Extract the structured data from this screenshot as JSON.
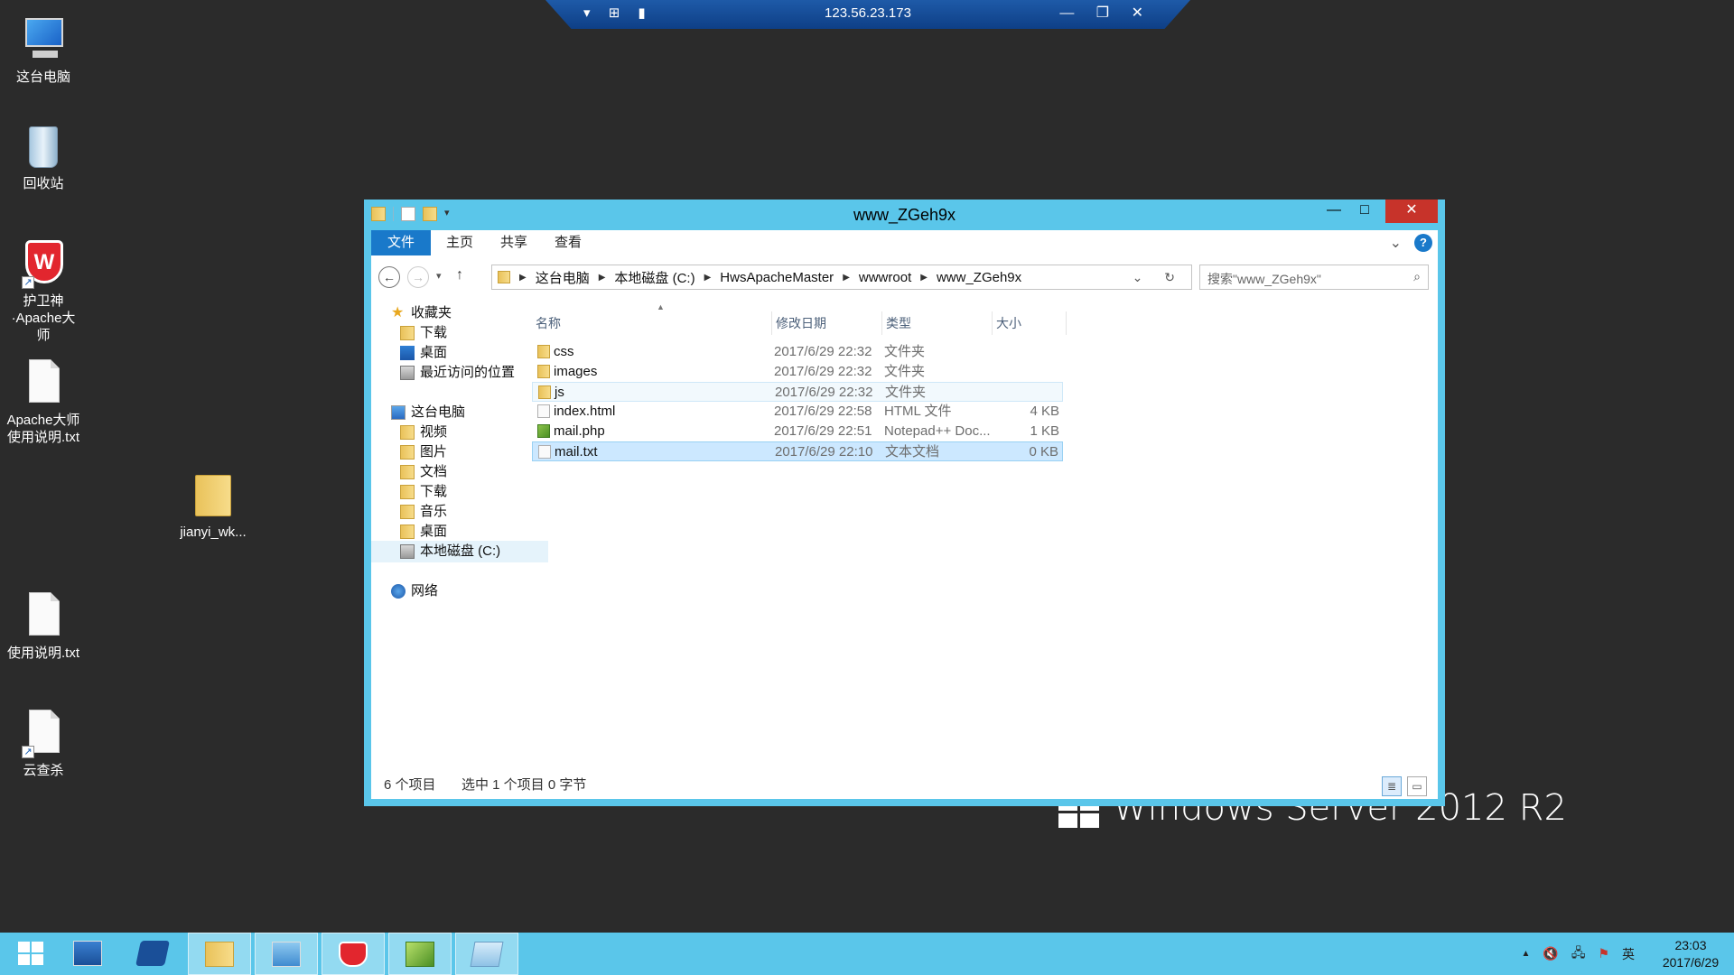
{
  "remote": {
    "host": "123.56.23.173",
    "left_icons": "▾ ⊞ ▮",
    "right_icons": "— ❐ ✕"
  },
  "desktop": {
    "icons": [
      {
        "label": "这台电脑",
        "icon": "computer-icon"
      },
      {
        "label": "回收站",
        "icon": "recycle-bin-icon"
      },
      {
        "label": "护卫神·Apache大师",
        "icon": "huweishen-shield-icon"
      },
      {
        "label": "Apache大师使用说明.txt",
        "icon": "text-file-icon"
      },
      {
        "label": "jianyi_wk...",
        "icon": "folder-icon"
      },
      {
        "label": "使用说明.txt",
        "icon": "text-file-icon"
      },
      {
        "label": "云查杀",
        "icon": "text-file-icon"
      }
    ],
    "watermark": "Windows Server 2012 R2"
  },
  "explorer": {
    "title": "www_ZGeh9x",
    "controls": {
      "min": "—",
      "max": "□",
      "close": "✕"
    },
    "ribbon_tabs": [
      "文件",
      "主页",
      "共享",
      "查看"
    ],
    "help": "?",
    "expand": "⌄",
    "nav_back": "←",
    "nav_fwd": "→",
    "nav_recent": "▾",
    "nav_up": "↑",
    "breadcrumbs": [
      "这台电脑",
      "本地磁盘 (C:)",
      "HwsApacheMaster",
      "wwwroot",
      "www_ZGeh9x"
    ],
    "crumb_sep": "▶",
    "address_tail": "⌄ ↻",
    "search_placeholder": "搜索\"www_ZGeh9x\"",
    "search_icon": "⌕",
    "nav_pane": {
      "favorites_label": "收藏夹",
      "favorites": [
        "下载",
        "桌面",
        "最近访问的位置"
      ],
      "pc_label": "这台电脑",
      "pc_items": [
        "视频",
        "图片",
        "文档",
        "下载",
        "音乐",
        "桌面",
        "本地磁盘 (C:)"
      ],
      "network_label": "网络"
    },
    "columns": {
      "name": "名称",
      "date": "修改日期",
      "type": "类型",
      "size": "大小"
    },
    "sort_indicator": "▲",
    "files": [
      {
        "name": "css",
        "date": "2017/6/29 22:32",
        "type": "文件夹",
        "size": "",
        "icon": "folder-icon"
      },
      {
        "name": "images",
        "date": "2017/6/29 22:32",
        "type": "文件夹",
        "size": "",
        "icon": "folder-icon"
      },
      {
        "name": "js",
        "date": "2017/6/29 22:32",
        "type": "文件夹",
        "size": "",
        "icon": "folder-icon"
      },
      {
        "name": "index.html",
        "date": "2017/6/29 22:58",
        "type": "HTML 文件",
        "size": "4 KB",
        "icon": "html-file-icon"
      },
      {
        "name": "mail.php",
        "date": "2017/6/29 22:51",
        "type": "Notepad++ Doc...",
        "size": "1 KB",
        "icon": "notepadpp-file-icon"
      },
      {
        "name": "mail.txt",
        "date": "2017/6/29 22:10",
        "type": "文本文档",
        "size": "0 KB",
        "icon": "text-file-icon"
      }
    ],
    "status": {
      "count": "6 个项目",
      "selection": "选中 1 个项目  0 字节"
    },
    "view_icons": {
      "details": "≣",
      "tiles": "▭"
    }
  },
  "taskbar": {
    "buttons": [
      "start-icon",
      "server-manager-icon",
      "powershell-icon",
      "file-explorer-icon",
      "remote-desktop-icon",
      "huweishen-shield-icon",
      "notepadpp-icon",
      "notepad-icon"
    ],
    "tray": {
      "chevron": "▲",
      "volume": "🔇",
      "network": "🖧",
      "flag": "⚑",
      "ime": "英"
    },
    "time": "23:03",
    "date": "2017/6/29"
  },
  "colors": {
    "accent": "#5ac6ea",
    "file_tab": "#1979ca",
    "close": "#c7332a"
  }
}
